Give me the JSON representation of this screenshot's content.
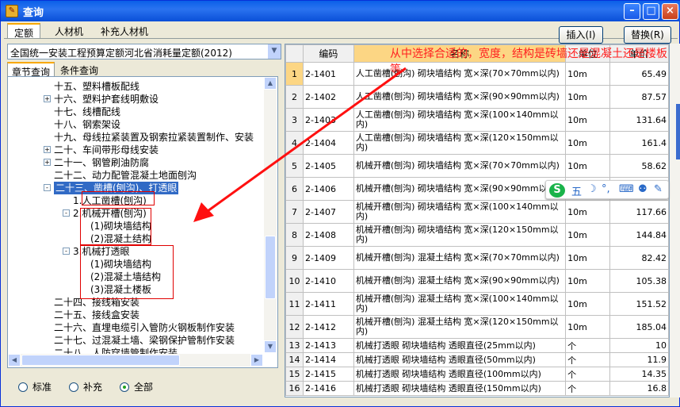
{
  "window": {
    "title": "查询",
    "app_icon": "app-icon"
  },
  "top_tabs": [
    "定额",
    "人材机",
    "补充人材机"
  ],
  "buttons": {
    "insert": "插入(I)",
    "replace": "替换(R)"
  },
  "quota_select": {
    "value": "全国统一安装工程预算定额河北省消耗量定额(2012)"
  },
  "sub_tabs": [
    "章节查询",
    "条件查询"
  ],
  "tree": [
    {
      "label": "十五、塑料槽板配线",
      "level": 1,
      "expander": ""
    },
    {
      "label": "十六、塑料护套线明敷设",
      "level": 1,
      "expander": "+"
    },
    {
      "label": "十七、线槽配线",
      "level": 1,
      "expander": ""
    },
    {
      "label": "十八、钢索架设",
      "level": 1,
      "expander": ""
    },
    {
      "label": "十九、母线拉紧装置及钢索拉紧装置制作、安装",
      "level": 1,
      "expander": ""
    },
    {
      "label": "二十、车间带形母线安装",
      "level": 1,
      "expander": "+"
    },
    {
      "label": "二十一、钢管刷油防腐",
      "level": 1,
      "expander": "+"
    },
    {
      "label": "二十二、动力配管混凝土地面刨沟",
      "level": 1,
      "expander": ""
    },
    {
      "label": "二十三、凿槽(刨沟)、打透眼",
      "level": 1,
      "expander": "-",
      "selected": true
    },
    {
      "label": "1.人工凿槽(刨沟)",
      "level": 2,
      "expander": ""
    },
    {
      "label": "2.机械开槽(刨沟)",
      "level": 2,
      "expander": "-"
    },
    {
      "label": "(1)砌块墙结构",
      "level": 3,
      "expander": ""
    },
    {
      "label": "(2)混凝土结构",
      "level": 3,
      "expander": ""
    },
    {
      "label": "3.机械打透眼",
      "level": 2,
      "expander": "-"
    },
    {
      "label": "(1)砌块墙结构",
      "level": 3,
      "expander": ""
    },
    {
      "label": "(2)混凝土墙结构",
      "level": 3,
      "expander": ""
    },
    {
      "label": "(3)混凝土楼板",
      "level": 3,
      "expander": ""
    },
    {
      "label": "二十四、接线箱安装",
      "level": 1,
      "expander": ""
    },
    {
      "label": "二十五、接线盒安装",
      "level": 1,
      "expander": ""
    },
    {
      "label": "二十六、直埋电缆引入管防火钢板制作安装",
      "level": 1,
      "expander": ""
    },
    {
      "label": "二十七、过混凝土墙、梁钢保护管制作安装",
      "level": 1,
      "expander": ""
    },
    {
      "label": "二十八、人防穿墙管制作安装",
      "level": 1,
      "expander": ""
    }
  ],
  "radios": [
    {
      "label": "标准",
      "checked": false
    },
    {
      "label": "补充",
      "checked": false
    },
    {
      "label": "全部",
      "checked": true
    }
  ],
  "grid": {
    "headers": [
      "",
      "编码",
      "名称",
      "单位",
      "单价"
    ],
    "rows": [
      [
        "1",
        "2-1401",
        "人工凿槽(刨沟) 砌块墙结构 宽×深(70×70mm以内)",
        "10m",
        "65.49"
      ],
      [
        "2",
        "2-1402",
        "人工凿槽(刨沟) 砌块墙结构 宽×深(90×90mm以内)",
        "10m",
        "87.57"
      ],
      [
        "3",
        "2-1403",
        "人工凿槽(刨沟) 砌块墙结构 宽×深(100×140mm以内)",
        "10m",
        "131.64"
      ],
      [
        "4",
        "2-1404",
        "人工凿槽(刨沟) 砌块墙结构 宽×深(120×150mm以内)",
        "10m",
        "161.4"
      ],
      [
        "5",
        "2-1405",
        "机械开槽(刨沟) 砌块墙结构 宽×深(70×70mm以内)",
        "10m",
        "58.62"
      ],
      [
        "6",
        "2-1406",
        "机械开槽(刨沟) 砌块墙结构 宽×深(90×90mm以内)",
        "10m",
        ""
      ],
      [
        "7",
        "2-1407",
        "机械开槽(刨沟) 砌块墙结构 宽×深(100×140mm以内)",
        "10m",
        "117.66"
      ],
      [
        "8",
        "2-1408",
        "机械开槽(刨沟) 砌块墙结构 宽×深(120×150mm以内)",
        "10m",
        "144.84"
      ],
      [
        "9",
        "2-1409",
        "机械开槽(刨沟) 混凝土结构 宽×深(70×70mm以内)",
        "10m",
        "82.42"
      ],
      [
        "10",
        "2-1410",
        "机械开槽(刨沟) 混凝土结构 宽×深(90×90mm以内)",
        "10m",
        "105.38"
      ],
      [
        "11",
        "2-1411",
        "机械开槽(刨沟) 混凝土结构 宽×深(100×140mm以内)",
        "10m",
        "151.52"
      ],
      [
        "12",
        "2-1412",
        "机械开槽(刨沟) 混凝土结构 宽×深(120×150mm以内)",
        "10m",
        "185.04"
      ],
      [
        "13",
        "2-1413",
        "机械打透眼 砌块墙结构 透眼直径(25mm以内)",
        "个",
        "10"
      ],
      [
        "14",
        "2-1414",
        "机械打透眼 砌块墙结构 透眼直径(50mm以内)",
        "个",
        "11.9"
      ],
      [
        "15",
        "2-1415",
        "机械打透眼 砌块墙结构 透眼直径(100mm以内)",
        "个",
        "14.35"
      ],
      [
        "16",
        "2-1416",
        "机械打透眼 砌块墙结构 透眼直径(150mm以内)",
        "个",
        "16.8"
      ]
    ]
  },
  "annotation": "从中选择合适的，宽度，结构是砖墙还是混凝土还是楼板等",
  "ime": {
    "logo": "S",
    "items": [
      "五",
      "☽",
      "°,",
      "⌨",
      "⚉",
      "✎"
    ]
  }
}
